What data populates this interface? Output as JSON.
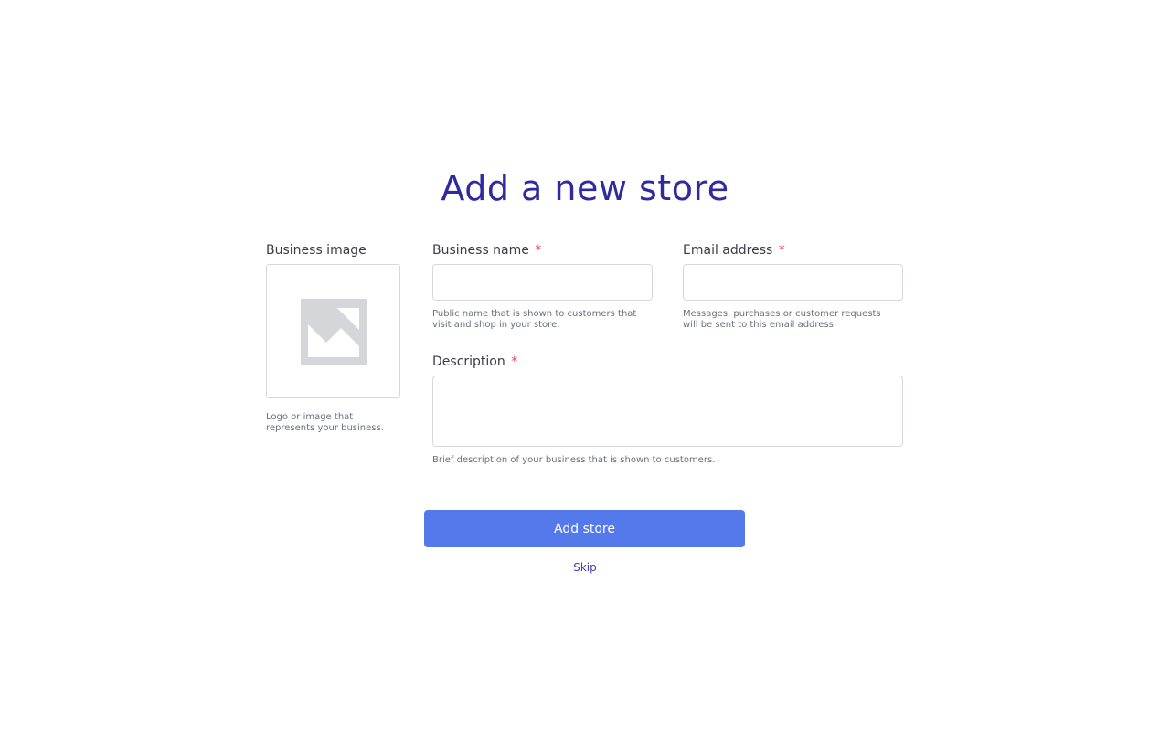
{
  "page": {
    "title": "Add a new store"
  },
  "form": {
    "business_image": {
      "label": "Business image",
      "hint": "Logo or image that represents your business.",
      "icon": "image-placeholder-icon"
    },
    "business_name": {
      "label": "Business name",
      "required_marker": "*",
      "value": "",
      "placeholder": "",
      "hint": "Public name that is shown to customers that visit and shop in your store."
    },
    "email_address": {
      "label": "Email address",
      "required_marker": "*",
      "value": "",
      "placeholder": "",
      "hint": "Messages, purchases or customer requests will be sent to this email address."
    },
    "description": {
      "label": "Description",
      "required_marker": "*",
      "value": "",
      "placeholder": "",
      "hint": "Brief description of your business that is shown to customers."
    }
  },
  "actions": {
    "submit_label": "Add store",
    "skip_label": "Skip"
  },
  "colors": {
    "title": "#2f2a9e",
    "required": "#e8456b",
    "primary_button": "#5479ea",
    "link": "#3f3fb0",
    "placeholder_icon": "#d4d6da"
  }
}
